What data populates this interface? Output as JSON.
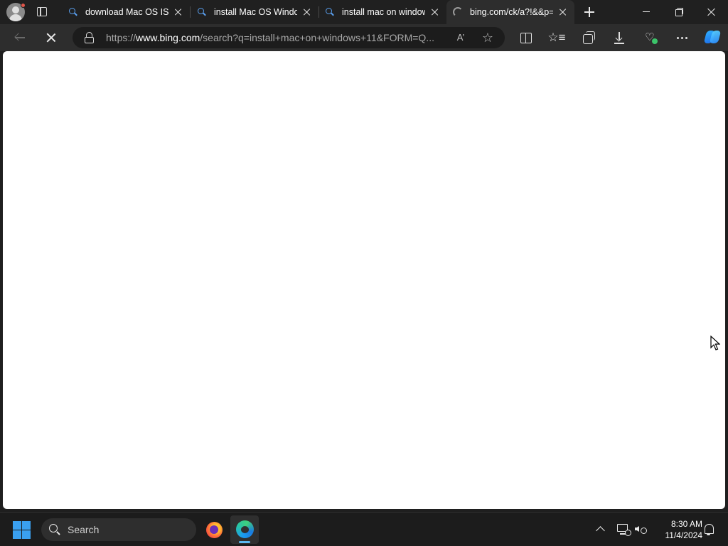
{
  "browser": {
    "tabs": [
      {
        "title": "download Mac OS ISO",
        "favicon": "search-icon",
        "active": false
      },
      {
        "title": "install Mac OS Windows",
        "favicon": "search-icon",
        "active": false
      },
      {
        "title": "install mac on windows",
        "favicon": "search-icon",
        "active": false
      },
      {
        "title": "bing.com/ck/a?!&&p=",
        "favicon": "loading-spinner-icon",
        "active": true
      }
    ],
    "address_bar": {
      "url_prefix": "https://",
      "url_host": "www.bing.com",
      "url_rest": "/search?q=install+mac+on+windows+11&FORM=Q..."
    },
    "read_aloud_label": "A’",
    "favorite_star": "☆",
    "favorites_glyph": "☆≡"
  },
  "taskbar": {
    "search_placeholder": "Search",
    "clock": {
      "time": "8:30 AM",
      "date": "11/4/2024"
    }
  },
  "colors": {
    "accent": "#3aa0f0",
    "page_background": "#ffffff",
    "chrome_background": "#202020"
  }
}
